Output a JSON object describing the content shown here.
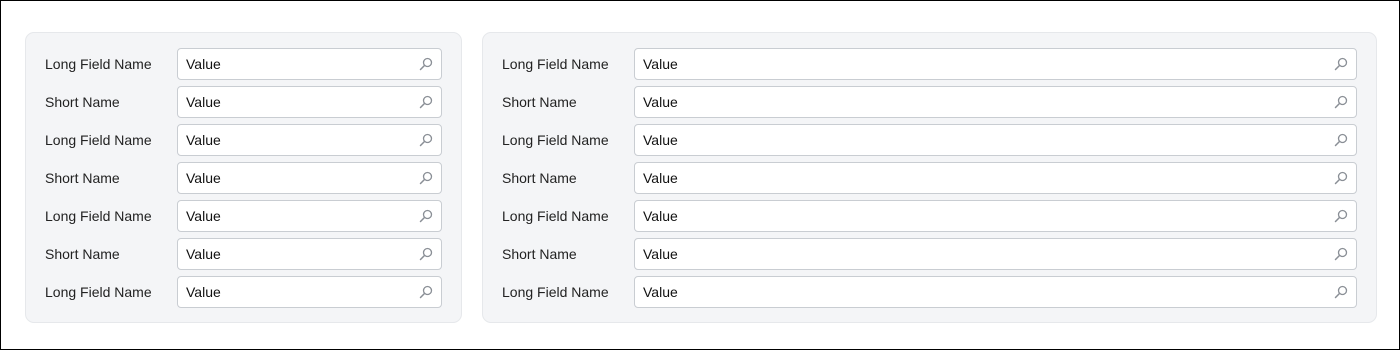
{
  "left_panel": {
    "rows": [
      {
        "label": "Long Field Name",
        "value": "Value"
      },
      {
        "label": "Short Name",
        "value": "Value"
      },
      {
        "label": "Long Field Name",
        "value": "Value"
      },
      {
        "label": "Short Name",
        "value": "Value"
      },
      {
        "label": "Long Field Name",
        "value": "Value"
      },
      {
        "label": "Short Name",
        "value": "Value"
      },
      {
        "label": "Long Field Name",
        "value": "Value"
      }
    ]
  },
  "right_panel": {
    "rows": [
      {
        "label": "Long Field Name",
        "value": "Value"
      },
      {
        "label": "Short Name",
        "value": "Value"
      },
      {
        "label": "Long Field Name",
        "value": "Value"
      },
      {
        "label": "Short Name",
        "value": "Value"
      },
      {
        "label": "Long Field Name",
        "value": "Value"
      },
      {
        "label": "Short Name",
        "value": "Value"
      },
      {
        "label": "Long Field Name",
        "value": "Value"
      }
    ]
  },
  "icons": {
    "field_action": "search-icon"
  },
  "colors": {
    "panel_background": "#f4f5f7",
    "field_border": "#c9cdd2",
    "icon": "#8a8f96"
  }
}
